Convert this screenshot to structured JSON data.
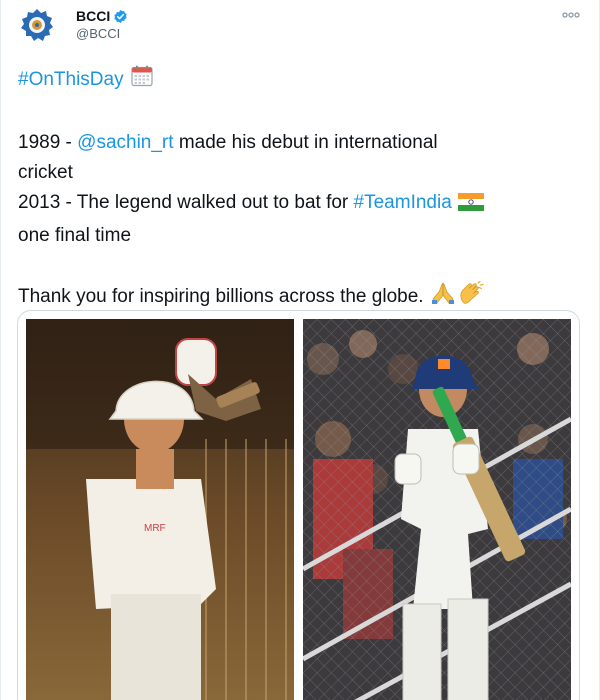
{
  "tweet": {
    "display_name": "BCCI",
    "handle": "@BCCI",
    "hashtag_line": {
      "hashtag": "#OnThisDay",
      "emoji": "calendar-emoji"
    },
    "line_1989": {
      "prefix": "1989 - ",
      "mention": "@sachin_rt",
      "suffix": " made his debut in international"
    },
    "line_cricket": "cricket",
    "line_2013": {
      "prefix": "2013 - The legend walked out to bat for ",
      "hashtag": "#TeamIndia",
      "emoji": "india-flag-emoji"
    },
    "line_final": "one final time",
    "line_thanks": {
      "text": "Thank you for inspiring billions across the globe.",
      "emojis": [
        "folded-hands-emoji",
        "clapping-hands-emoji"
      ]
    },
    "media": [
      {
        "description_icon": "photo-young-batsman"
      },
      {
        "description_icon": "photo-batsman-walking-out"
      }
    ]
  },
  "colors": {
    "link": "#1b95e0",
    "text": "#0f1419",
    "secondary": "#536471",
    "verified": "#1d9bf0",
    "border": "#cfd9de"
  }
}
